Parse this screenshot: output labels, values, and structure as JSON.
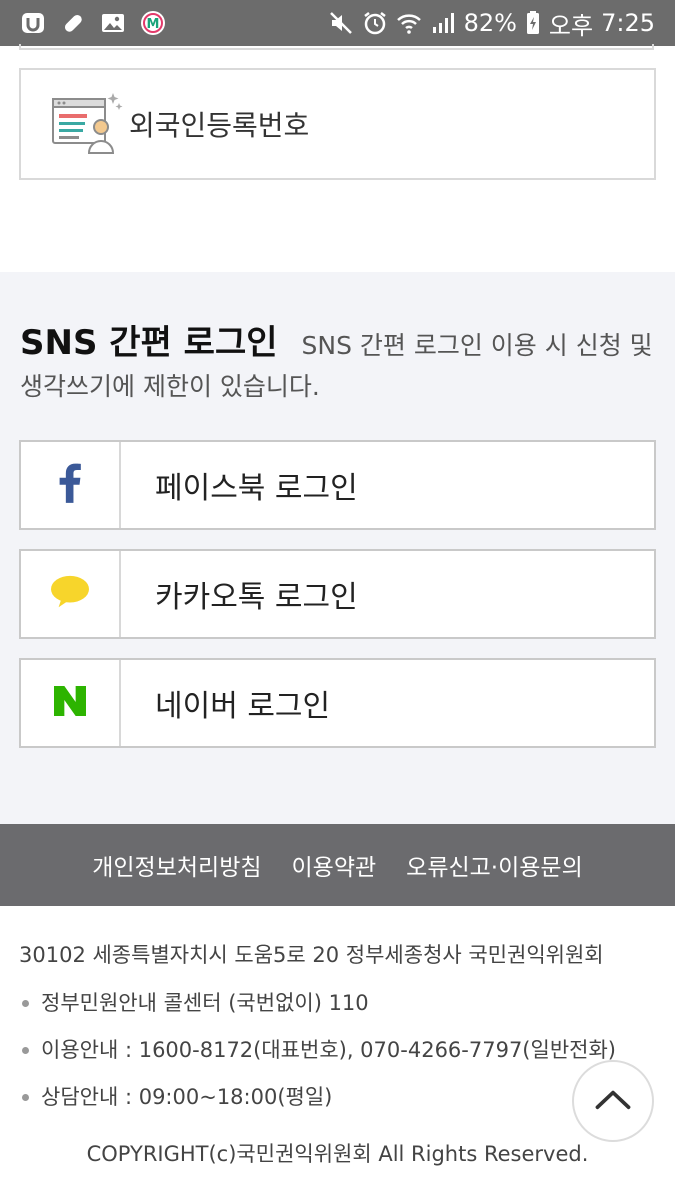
{
  "status_bar": {
    "battery": "82%",
    "ampm": "오후",
    "time": "7:25",
    "left_icons": [
      "app-u-icon",
      "bandage-icon",
      "image-icon",
      "m-app-icon"
    ],
    "right_icons": [
      "mute-icon",
      "alarm-icon",
      "wifi-icon",
      "signal-icon",
      "battery-icon"
    ]
  },
  "alien_card": {
    "label": "외국인등록번호",
    "icon": "foreigner-id-card-icon"
  },
  "sns": {
    "title": "SNS 간편 로그인",
    "description": "SNS 간편 로그인 이용 시 신청 및 생각쓰기에 제한이 있습니다.",
    "buttons": [
      {
        "label": "페이스북 로그인",
        "icon": "facebook-icon",
        "color": "#3b5998"
      },
      {
        "label": "카카오톡 로그인",
        "icon": "kakaotalk-icon",
        "color": "#f7d52b"
      },
      {
        "label": "네이버 로그인",
        "icon": "naver-icon",
        "color": "#2db400"
      }
    ]
  },
  "footer_nav": {
    "links": [
      "개인정보처리방침",
      "이용약관",
      "오류신고·이용문의"
    ]
  },
  "footer_info": {
    "address": "30102 세종특별자치시 도움5로 20 정부세종청사 국민권익위원회",
    "items": [
      "정부민원안내 콜센터 (국번없이) 110",
      "이용안내 : 1600-8172(대표번호), 070-4266-7797(일반전화)",
      "상담안내 : 09:00~18:00(평일)"
    ],
    "copyright": "COPYRIGHT(c)국민권익위원회 All Rights Reserved."
  },
  "scroll_top": {
    "icon": "chevron-up-icon"
  }
}
